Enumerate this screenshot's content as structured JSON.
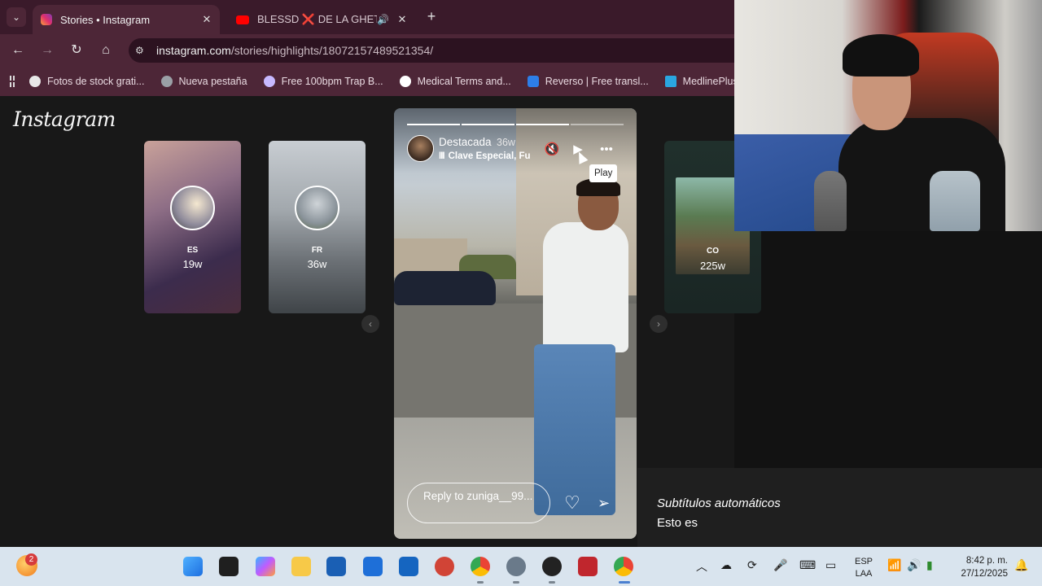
{
  "browser": {
    "tabs": [
      {
        "title": "Stories • Instagram",
        "active": true
      },
      {
        "title": "BLESSD ❌ DE LA GHETTO",
        "active": false
      }
    ],
    "url_host": "instagram.com",
    "url_path": "/stories/highlights/18072157489521354/",
    "bookmarks": [
      {
        "label": "Fotos de stock grati...",
        "color": "#e8e8e8"
      },
      {
        "label": "Nueva pestaña",
        "color": "#9aa0a6"
      },
      {
        "label": "Free 100bpm Trap B...",
        "color": "#c7b9ff"
      },
      {
        "label": "Medical Terms and...",
        "color": "#ffffff"
      },
      {
        "label": "Reverso | Free transl...",
        "color": "#2d7ee8"
      },
      {
        "label": "MedlinePlus - Inf",
        "color": "#2aa6e0"
      }
    ]
  },
  "instagram": {
    "logo": "Instagram",
    "highlights": [
      {
        "name": "ES",
        "time": "19w"
      },
      {
        "name": "FR",
        "time": "36w"
      },
      {
        "name": "CO",
        "time": "225w"
      }
    ],
    "story": {
      "user": "Destacada",
      "time": "36w",
      "audio_bars": "III",
      "audio": "Clave Especial, Fu",
      "tooltip": "Play",
      "reply_placeholder": "Reply to zuniga__99..."
    }
  },
  "captions": {
    "title": "Subtítulos automáticos",
    "text": "Esto es"
  },
  "taskbar": {
    "notification_count": "2",
    "lang_top": "ESP",
    "lang_bottom": "LAA",
    "time": "8:42 p. m.",
    "date": "27/12/2025"
  },
  "colors": {
    "tab_strip": "#3a1a2a",
    "toolbar": "#4d2637",
    "ig_background": "#181818",
    "taskbar": "#d9e4ee"
  }
}
